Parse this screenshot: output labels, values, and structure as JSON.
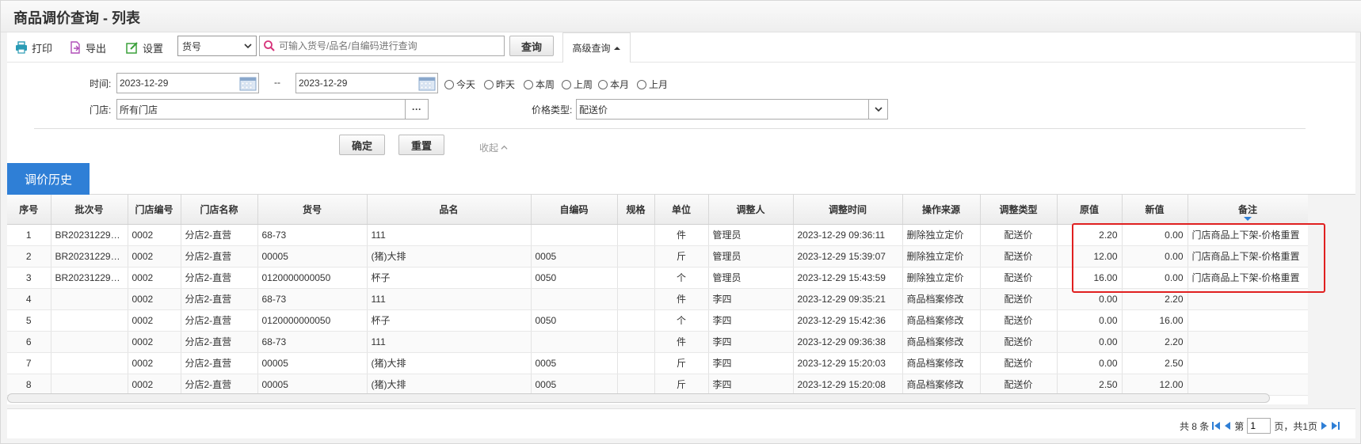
{
  "title": "商品调价查询 - 列表",
  "toolbar": {
    "print_label": "打印",
    "export_label": "导出",
    "settings_label": "设置",
    "field_select_value": "货号",
    "search_placeholder": "可输入货号/品名/自编码进行查询",
    "query_label": "查询",
    "advanced_label": "高级查询"
  },
  "filters": {
    "time_label": "时间:",
    "date_from": "2023-12-29",
    "date_sep": "--",
    "date_to": "2023-12-29",
    "quick_ranges": [
      "今天",
      "昨天",
      "本周",
      "上周",
      "本月",
      "上月"
    ],
    "store_label": "门店:",
    "store_value": "所有门店",
    "store_more": "···",
    "price_type_label": "价格类型:",
    "price_type_value": "配送价",
    "confirm_label": "确定",
    "reset_label": "重置",
    "collapse_label": "收起"
  },
  "tab": {
    "label": "调价历史"
  },
  "table": {
    "columns": [
      "序号",
      "批次号",
      "门店编号",
      "门店名称",
      "货号",
      "品名",
      "自编码",
      "规格",
      "单位",
      "调整人",
      "调整时间",
      "操作来源",
      "调整类型",
      "原值",
      "新值",
      "备注"
    ],
    "rows": [
      [
        "1",
        "BR202312290…",
        "0002",
        "分店2-直营",
        "68-73",
        "111",
        "",
        "",
        "件",
        "管理员",
        "2023-12-29 09:36:11",
        "删除独立定价",
        "配送价",
        "2.20",
        "0.00",
        "门店商品上下架-价格重置"
      ],
      [
        "2",
        "BR202312291…",
        "0002",
        "分店2-直营",
        "00005",
        "(猪)大排",
        "0005",
        "",
        "斤",
        "管理员",
        "2023-12-29 15:39:07",
        "删除独立定价",
        "配送价",
        "12.00",
        "0.00",
        "门店商品上下架-价格重置"
      ],
      [
        "3",
        "BR202312291…",
        "0002",
        "分店2-直营",
        "0120000000050",
        "杯子",
        "0050",
        "",
        "个",
        "管理员",
        "2023-12-29 15:43:59",
        "删除独立定价",
        "配送价",
        "16.00",
        "0.00",
        "门店商品上下架-价格重置"
      ],
      [
        "4",
        "",
        "0002",
        "分店2-直营",
        "68-73",
        "111",
        "",
        "",
        "件",
        "李四",
        "2023-12-29 09:35:21",
        "商品档案修改",
        "配送价",
        "0.00",
        "2.20",
        ""
      ],
      [
        "5",
        "",
        "0002",
        "分店2-直营",
        "0120000000050",
        "杯子",
        "0050",
        "",
        "个",
        "李四",
        "2023-12-29 15:42:36",
        "商品档案修改",
        "配送价",
        "0.00",
        "16.00",
        ""
      ],
      [
        "6",
        "",
        "0002",
        "分店2-直营",
        "68-73",
        "111",
        "",
        "",
        "件",
        "李四",
        "2023-12-29 09:36:38",
        "商品档案修改",
        "配送价",
        "0.00",
        "2.20",
        ""
      ],
      [
        "7",
        "",
        "0002",
        "分店2-直营",
        "00005",
        "(猪)大排",
        "0005",
        "",
        "斤",
        "李四",
        "2023-12-29 15:20:03",
        "商品档案修改",
        "配送价",
        "0.00",
        "2.50",
        ""
      ],
      [
        "8",
        "",
        "0002",
        "分店2-直营",
        "00005",
        "(猪)大排",
        "0005",
        "",
        "斤",
        "李四",
        "2023-12-29 15:20:08",
        "商品档案修改",
        "配送价",
        "2.50",
        "12.00",
        ""
      ]
    ]
  },
  "pager": {
    "total_text": "共 8 条",
    "page_prefix": "第",
    "page_value": "1",
    "page_suffix": "页，共1页"
  },
  "colors": {
    "accent": "#2f7fd6",
    "highlight": "#e02020"
  }
}
